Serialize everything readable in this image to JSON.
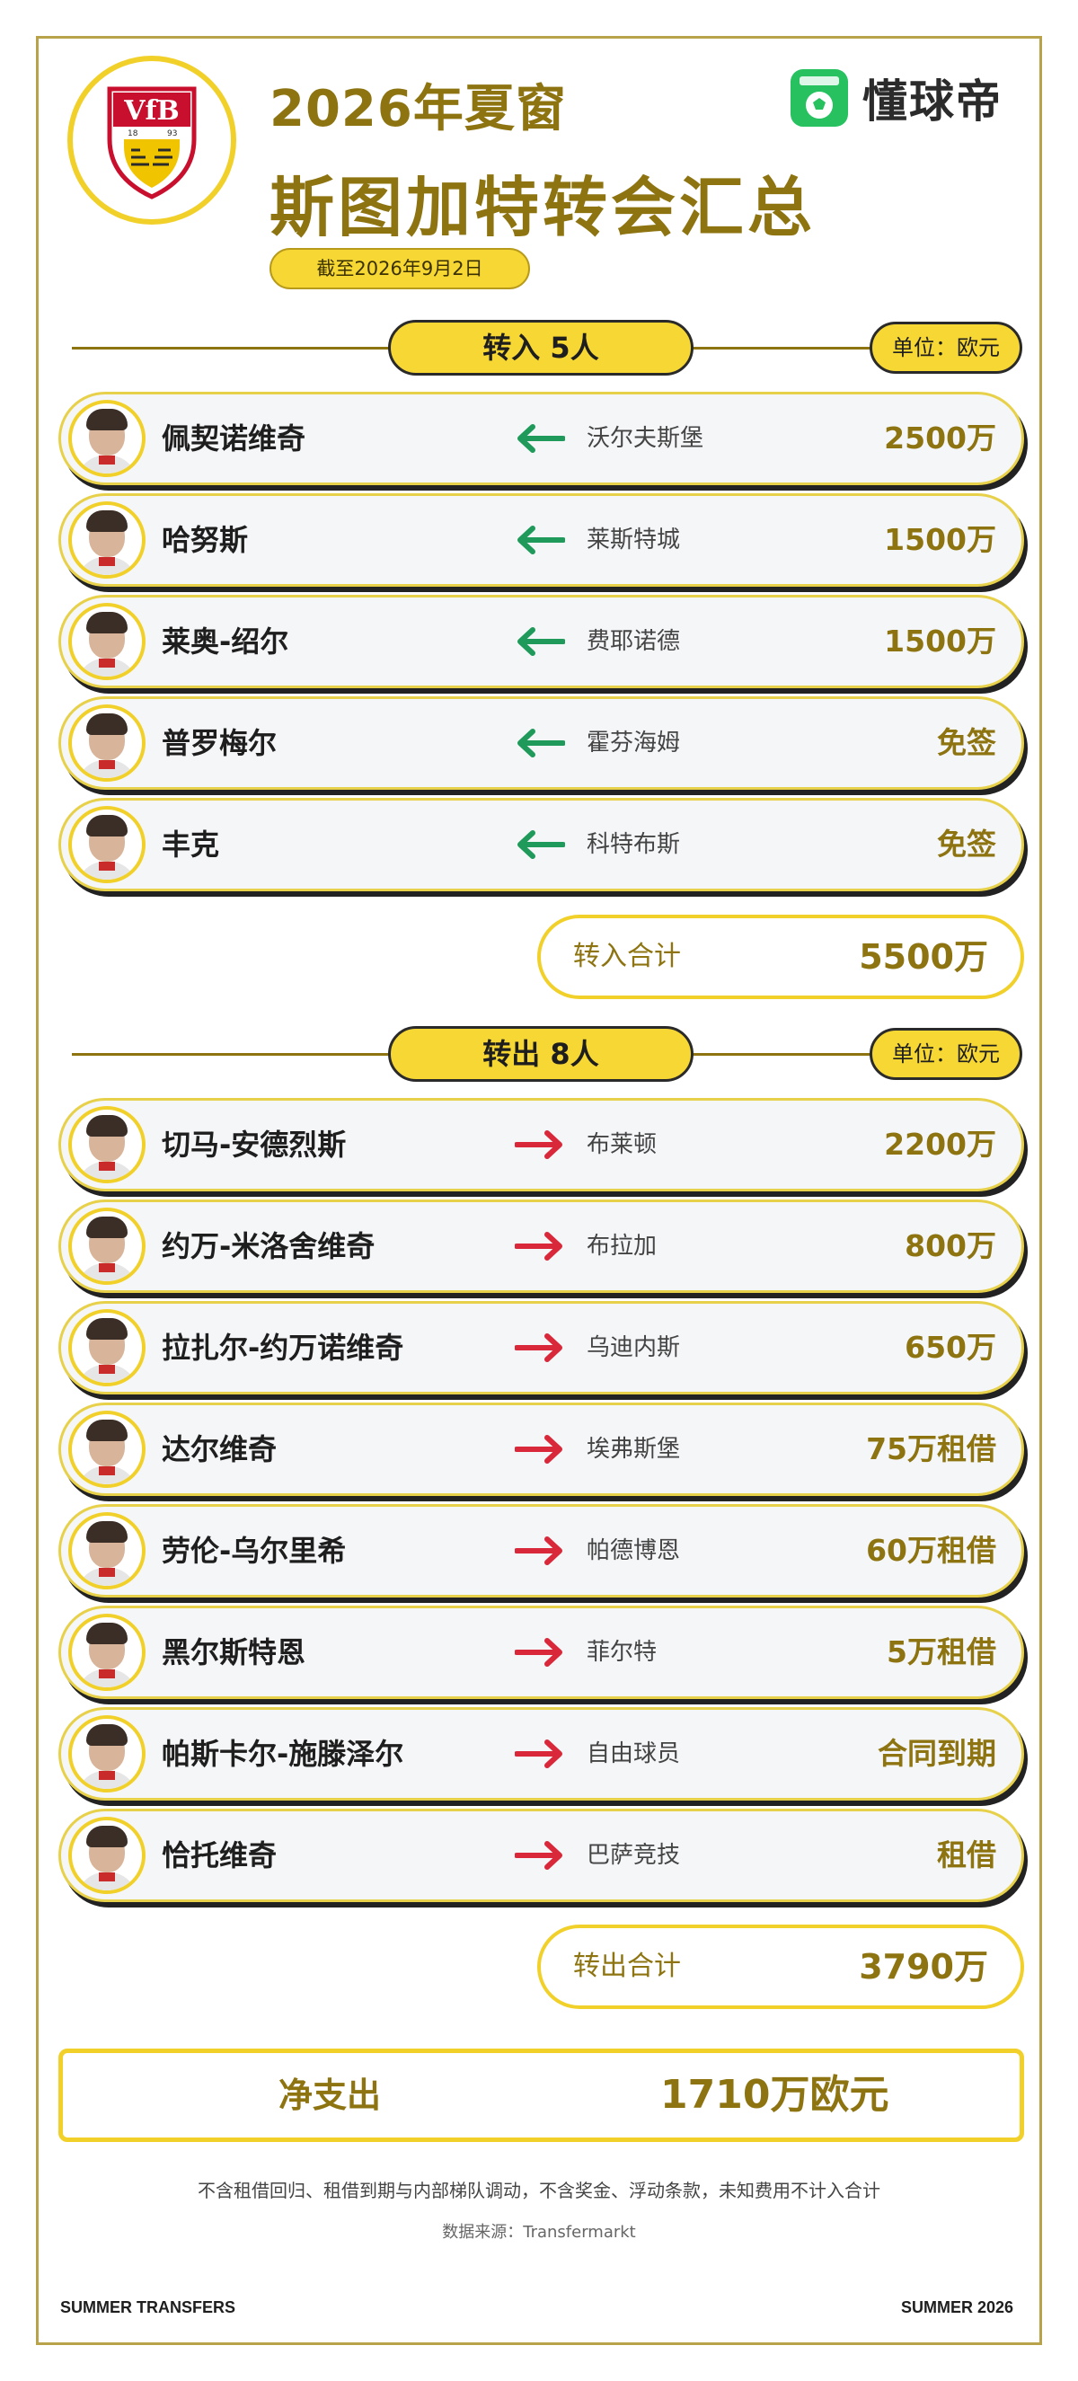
{
  "header": {
    "title_year": "2026年夏窗",
    "title_main": "斯图加特转会汇总",
    "date": "截至2026年9月2日",
    "brand_name": "懂球帝",
    "club_logo": "vfb-stuttgart-crest"
  },
  "incoming": {
    "heading": "转入 5人",
    "unit": "单位：欧元",
    "players": [
      {
        "name": "佩契诺维奇",
        "club": "沃尔夫斯堡",
        "fee": "2500万"
      },
      {
        "name": "哈努斯",
        "club": "莱斯特城",
        "fee": "1500万"
      },
      {
        "name": "莱奥-绍尔",
        "club": "费耶诺德",
        "fee": "1500万"
      },
      {
        "name": "普罗梅尔",
        "club": "霍芬海姆",
        "fee": "免签"
      },
      {
        "name": "丰克",
        "club": "科特布斯",
        "fee": "免签"
      }
    ],
    "total_label": "转入合计",
    "total_value": "5500万"
  },
  "outgoing": {
    "heading": "转出 8人",
    "unit": "单位：欧元",
    "players": [
      {
        "name": "切马-安德烈斯",
        "club": "布莱顿",
        "fee": "2200万"
      },
      {
        "name": "约万-米洛舍维奇",
        "club": "布拉加",
        "fee": "800万"
      },
      {
        "name": "拉扎尔-约万诺维奇",
        "club": "乌迪内斯",
        "fee": "650万"
      },
      {
        "name": "达尔维奇",
        "club": "埃弗斯堡",
        "fee": "75万租借"
      },
      {
        "name": "劳伦-乌尔里希",
        "club": "帕德博恩",
        "fee": "60万租借"
      },
      {
        "name": "黑尔斯特恩",
        "club": "菲尔特",
        "fee": "5万租借"
      },
      {
        "name": "帕斯卡尔-施滕泽尔",
        "club": "自由球员",
        "fee": "合同到期"
      },
      {
        "name": "恰托维奇",
        "club": "巴萨竞技",
        "fee": "租借"
      }
    ],
    "total_label": "转出合计",
    "total_value": "3790万"
  },
  "net": {
    "label": "净支出",
    "value": "1710万欧元"
  },
  "footer": {
    "note": "不含租借回归、租借到期与内部梯队调动，不含奖金、浮动条款，未知费用不计入合计",
    "source": "数据来源：Transfermarkt",
    "left": "SUMMER TRANSFERS",
    "right": "SUMMER 2026"
  },
  "colors": {
    "accent_gold": "#8d7411",
    "pill_yellow": "#f6d734",
    "incoming_arrow": "#1f9a5a",
    "outgoing_arrow": "#d8283a",
    "brand_green": "#27c15f"
  },
  "icons": {
    "incoming_arrow": "arrow-left-icon",
    "outgoing_arrow": "arrow-right-icon",
    "brand": "football-app-icon"
  }
}
